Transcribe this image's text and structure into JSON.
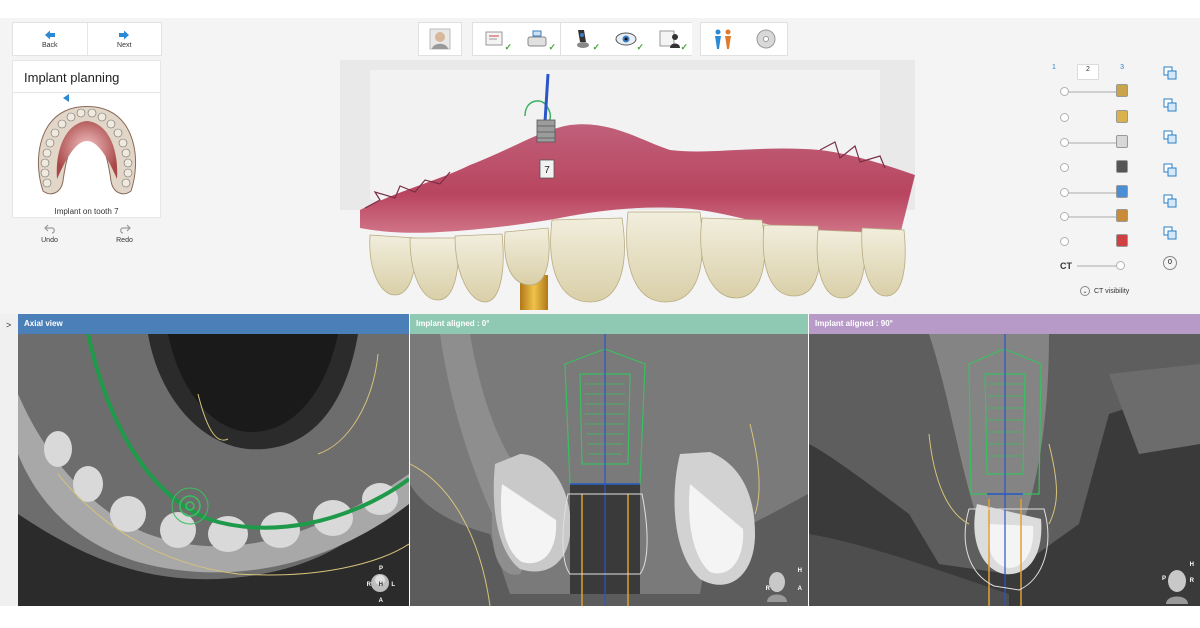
{
  "nav": {
    "back_label": "Back",
    "next_label": "Next"
  },
  "plan_panel": {
    "title": "Implant planning",
    "caption": "Implant on tooth 7"
  },
  "edit": {
    "undo_label": "Undo",
    "redo_label": "Redo"
  },
  "workflow": {
    "steps": [
      {
        "icon": "patient-photo-icon",
        "done": false
      },
      {
        "icon": "prescription-icon",
        "done": true
      },
      {
        "icon": "scan-import-icon",
        "done": true
      },
      {
        "icon": "scanner-icon",
        "done": true
      },
      {
        "icon": "eye-view-icon",
        "done": true
      },
      {
        "icon": "design-icon",
        "done": true
      },
      {
        "icon": "people-icon",
        "done": false
      },
      {
        "icon": "disc-icon",
        "done": false
      }
    ],
    "check_glyph": "✓"
  },
  "scene": {
    "tooth_tag": "7"
  },
  "right_panel": {
    "tabs": [
      "1",
      "2",
      "3"
    ],
    "selected_tab": "2",
    "sliders": [
      {
        "name": "gingiva-opacity",
        "value": 1.0,
        "color": "#c9a44a"
      },
      {
        "name": "prep-opacity",
        "value": 0.0,
        "color": "#d9b24e"
      },
      {
        "name": "antagonist-opacity",
        "value": 1.0,
        "color": "#d8d8d8"
      },
      {
        "name": "abutment-opacity",
        "value": 0.0,
        "color": "#555555"
      },
      {
        "name": "implant-opacity",
        "value": 1.0,
        "color": "#4a8fd4"
      },
      {
        "name": "sleeve-opacity",
        "value": 1.0,
        "color": "#c98a3a"
      },
      {
        "name": "drill-opacity",
        "value": 0.0,
        "color": "#d04040"
      },
      {
        "name": "ct-opacity",
        "value": 1.0,
        "color": "#ffffff"
      }
    ],
    "ct_label": "CT",
    "ct_visibility_label": "CT visibility",
    "ct_visibility_glyph": "⌄",
    "right_icons": [
      "copy-icon",
      "copy-icon",
      "copy-icon",
      "copy-icon",
      "copy-icon",
      "copy-icon",
      "info-icon"
    ],
    "info_glyph": "0"
  },
  "views": [
    {
      "title": "Axial view",
      "color": "#4a7fb8",
      "labels": [
        "P",
        "R",
        "H",
        "L",
        "A"
      ]
    },
    {
      "title": "Implant aligned : 0°",
      "color": "#8fc9b4",
      "labels": [
        "H",
        "R",
        "A"
      ]
    },
    {
      "title": "Implant aligned : 90°",
      "color": "#b89ac8",
      "labels": [
        "H",
        "P",
        "R"
      ]
    }
  ],
  "sidebar": {
    "toggle_label": ">"
  }
}
